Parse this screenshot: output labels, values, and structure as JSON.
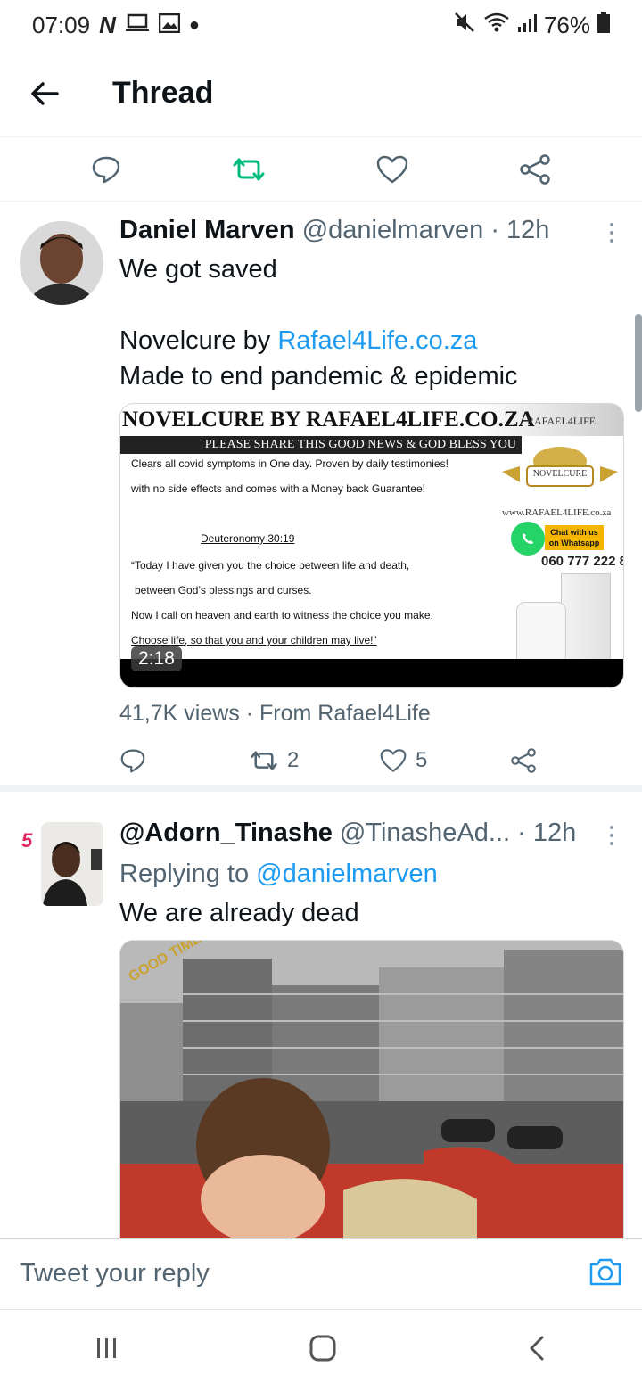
{
  "status": {
    "time": "07:09",
    "battery": "76%"
  },
  "topbar": {
    "title": "Thread"
  },
  "tweet1": {
    "name": "Daniel Marven",
    "handle": "@danielmarven",
    "time": "· 12h",
    "line1": "We got saved",
    "line2_prefix": "Novelcure by ",
    "line2_link": "Rafael4Life.co.za",
    "line3": "Made to end pandemic & epidemic",
    "video": {
      "title": "NOVELCURE BY RAFAEL4LIFE.CO.ZA",
      "subtitle": "PLEASE SHARE THIS GOOD NEWS & GOD BLESS YOU",
      "line_a": "Clears all covid symptoms in One day. Proven by daily testimonies!",
      "line_b": "with no side effects and comes with a Money back Guarantee!",
      "verse_ref": "Deuteronomy 30:19",
      "verse_1": "“Today I have given you the choice between life and death,",
      "verse_2": "between God’s blessings and curses.",
      "verse_3": "Now I call on heaven and earth to witness the choice you make.",
      "verse_4": "Choose life, so that you and your children may live!”",
      "brand": "RAFAEL4LIFE",
      "product": "NOVELCURE",
      "site": "www.RAFAEL4LIFE.co.za",
      "chat": "Chat with us on Whatsapp",
      "phone": "060 777 222 8",
      "duration": "2:18"
    },
    "views": "41,7K views",
    "source": "· From Rafael4Life",
    "retweets": "2",
    "likes": "5"
  },
  "tweet2": {
    "name": "@Adorn_Tinashe",
    "handle": "@TinasheAd...",
    "time": "· 12h",
    "replying_prefix": "Replying to ",
    "replying_to": "@danielmarven",
    "text": "We are already dead",
    "media_sign": "GOOD TIMES"
  },
  "reply": {
    "placeholder": "Tweet your reply"
  },
  "colors": {
    "accent": "#1d9bf0",
    "retweet": "#00ba7c",
    "muted": "#536471"
  }
}
